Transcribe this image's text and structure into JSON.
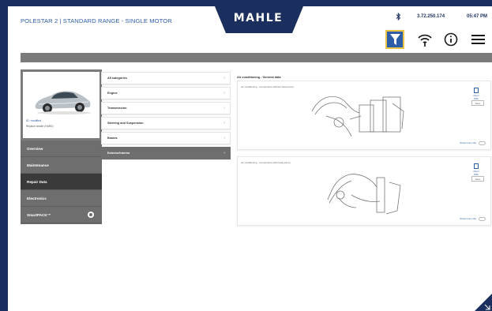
{
  "header": {
    "vehicle_title": "POLESTAR 2 | STANDARD RANGE - SINGLE MOTOR",
    "logo_text": "MAHLE",
    "ip": "3.72.250.174",
    "time": "05:47 PM",
    "brand_color": "#1a2f5e",
    "accent_color": "#2f5ea8",
    "highlight_color": "#e8c54a"
  },
  "vehicle_card": {
    "link_text": "ID: modified",
    "sub_text": "Replace header (HARD)"
  },
  "nav": {
    "items": [
      {
        "label": "Overview"
      },
      {
        "label": "Maintenance"
      },
      {
        "label": "Repair Data"
      },
      {
        "label": "Electronics"
      },
      {
        "label": "SmartPACK™"
      }
    ],
    "active_index": 2
  },
  "categories": {
    "items": [
      {
        "label": "All categories"
      },
      {
        "label": "Engine"
      },
      {
        "label": "Transmission"
      },
      {
        "label": "Steering and Suspension"
      },
      {
        "label": "Brakes"
      },
      {
        "label": "Exterior/Interior"
      }
    ],
    "active_index": 5
  },
  "content": {
    "title": "Air conditioning - General data",
    "cards": [
      {
        "caption": "Air conditioning - components (without heat pump)",
        "pdf_label": "Open PDF",
        "button_label": "Save",
        "link_label": "Show more info"
      },
      {
        "caption": "Air conditioning - components (with heat pump)",
        "pdf_label": "Open PDF",
        "button_label": "Save",
        "link_label": "Show more info"
      }
    ]
  }
}
